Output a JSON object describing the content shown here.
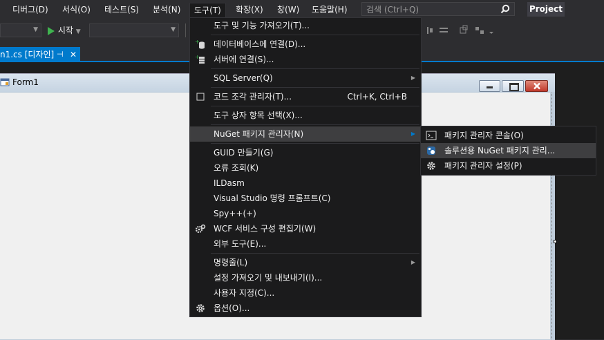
{
  "menubar": {
    "items": [
      "디버그(D)",
      "서식(O)",
      "테스트(S)",
      "분석(N)",
      "도구(T)",
      "확장(X)",
      "창(W)",
      "도움말(H)"
    ],
    "search_placeholder": "검색 (Ctrl+Q)",
    "project_badge": "Project"
  },
  "toolbar": {
    "start_label": "시작"
  },
  "tab": {
    "label": "n1.cs [디자인]",
    "pin": "⊣",
    "close": "✕"
  },
  "form": {
    "title": "Form1"
  },
  "tools_menu": {
    "items": [
      {
        "label": "도구 및 기능 가져오기(T)...",
        "shortcut": "",
        "submenu": false,
        "icon": ""
      },
      {
        "label": "데이터베이스에 연결(D)...",
        "shortcut": "",
        "submenu": false,
        "icon": "database-plus-icon"
      },
      {
        "label": "서버에 연결(S)...",
        "shortcut": "",
        "submenu": false,
        "icon": "server-plus-icon"
      },
      {
        "label": "SQL Server(Q)",
        "shortcut": "",
        "submenu": true,
        "icon": ""
      },
      {
        "label": "코드 조각 관리자(T)...",
        "shortcut": "Ctrl+K, Ctrl+B",
        "submenu": false,
        "icon": "checkbox-icon"
      },
      {
        "label": "도구 상자 항목 선택(X)...",
        "shortcut": "",
        "submenu": false,
        "icon": ""
      },
      {
        "label": "NuGet 패키지 관리자(N)",
        "shortcut": "",
        "submenu": true,
        "icon": ""
      },
      {
        "label": "GUID 만들기(G)",
        "shortcut": "",
        "submenu": false,
        "icon": ""
      },
      {
        "label": "오류 조회(K)",
        "shortcut": "",
        "submenu": false,
        "icon": ""
      },
      {
        "label": "ILDasm",
        "shortcut": "",
        "submenu": false,
        "icon": ""
      },
      {
        "label": "Visual Studio 명령 프롬프트(C)",
        "shortcut": "",
        "submenu": false,
        "icon": ""
      },
      {
        "label": "Spy++(+)",
        "shortcut": "",
        "submenu": false,
        "icon": ""
      },
      {
        "label": "WCF 서비스 구성 편집기(W)",
        "shortcut": "",
        "submenu": false,
        "icon": "gears-icon"
      },
      {
        "label": "외부 도구(E)...",
        "shortcut": "",
        "submenu": false,
        "icon": ""
      },
      {
        "label": "명령줄(L)",
        "shortcut": "",
        "submenu": true,
        "icon": ""
      },
      {
        "label": "설정 가져오기 및 내보내기(I)...",
        "shortcut": "",
        "submenu": false,
        "icon": ""
      },
      {
        "label": "사용자 지정(C)...",
        "shortcut": "",
        "submenu": false,
        "icon": ""
      },
      {
        "label": "옵션(O)...",
        "shortcut": "",
        "submenu": false,
        "icon": "gear-icon"
      }
    ]
  },
  "nuget_submenu": {
    "items": [
      {
        "label": "패키지 관리자 콘솔(O)",
        "icon": "console-icon"
      },
      {
        "label": "솔루션용 NuGet 패키지 관리...",
        "icon": "nuget-package-icon"
      },
      {
        "label": "패키지 관리자 설정(P)",
        "icon": "gear-icon"
      }
    ]
  },
  "colors": {
    "accent": "#007acc",
    "menu_bg": "#1b1b1c",
    "menu_highlight": "#3e3e40",
    "chrome_bg": "#2d2d30"
  }
}
